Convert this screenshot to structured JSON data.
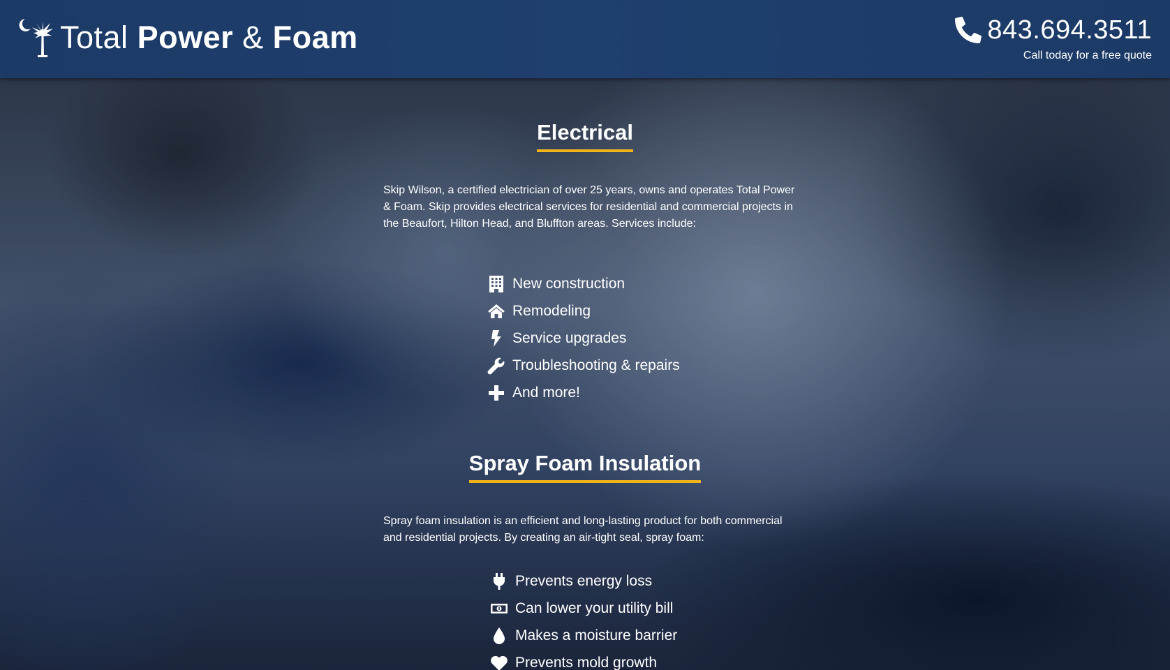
{
  "header": {
    "brand": {
      "word1": "Total",
      "word2": "Power",
      "amp": "&",
      "word3": "Foam",
      "icon": "palmetto-moon-icon"
    },
    "phone": {
      "number": "843.694.3511",
      "subtext": "Call today for a free quote",
      "icon": "phone-icon"
    }
  },
  "sections": [
    {
      "title": "Electrical",
      "paragraph": "Skip Wilson, a certified electrician of over 25 years, owns and operates Total Power & Foam. Skip provides electrical services for residential and commercial projects in the Beaufort, Hilton Head, and Bluffton areas. Services include:",
      "items": [
        {
          "icon": "building-icon",
          "label": "New construction"
        },
        {
          "icon": "home-icon",
          "label": "Remodeling"
        },
        {
          "icon": "lightning-bolt-icon",
          "label": "Service upgrades"
        },
        {
          "icon": "wrench-icon",
          "label": "Troubleshooting & repairs"
        },
        {
          "icon": "plus-icon",
          "label": "And more!"
        }
      ]
    },
    {
      "title": "Spray Foam Insulation",
      "paragraph": "Spray foam insulation is an efficient and long-lasting product for both commercial and residential projects. By creating an air-tight seal, spray foam:",
      "items": [
        {
          "icon": "plug-icon",
          "label": "Prevents energy loss"
        },
        {
          "icon": "money-bill-icon",
          "label": "Can lower your utility bill"
        },
        {
          "icon": "water-drop-icon",
          "label": "Makes a moisture barrier"
        },
        {
          "icon": "heart-icon",
          "label": "Prevents mold growth"
        }
      ]
    }
  ],
  "colors": {
    "header_bg": "#1f3f6e",
    "accent_underline": "#f2b418",
    "text": "#ffffff"
  }
}
